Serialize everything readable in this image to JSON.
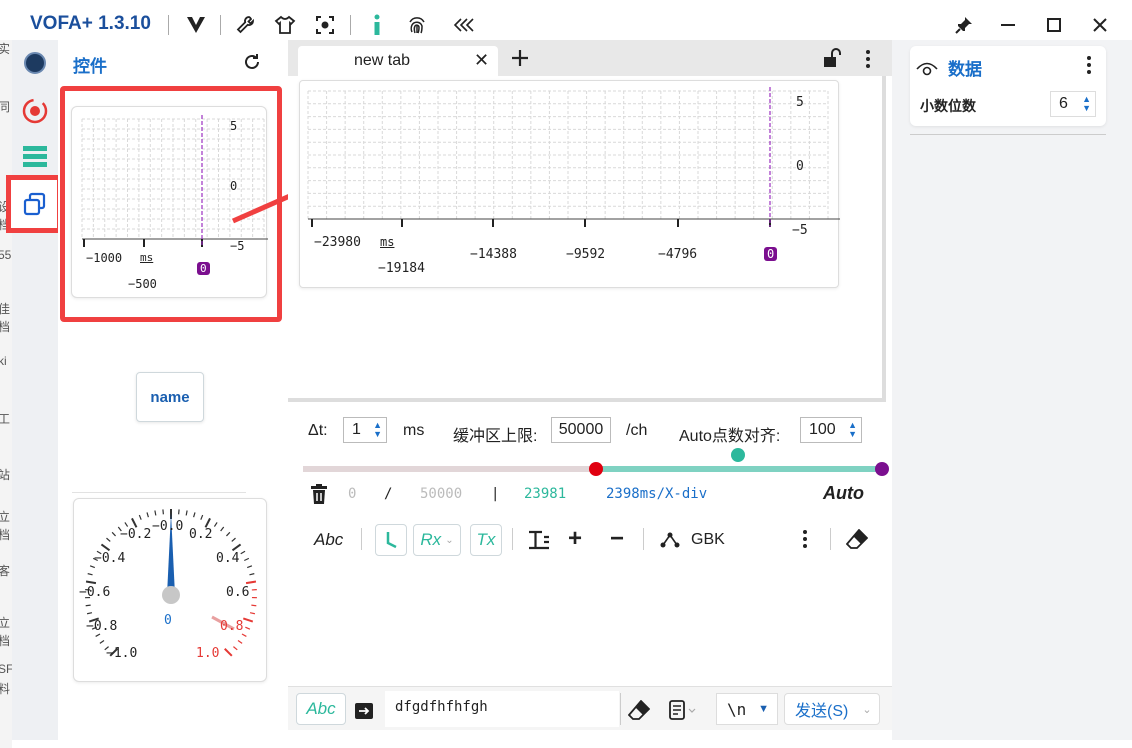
{
  "app": {
    "title": "VOFA+ 1.3.10"
  },
  "left_strip_chars": [
    "实",
    "同",
    "设",
    "档",
    "55",
    "佳",
    "档",
    "ki",
    "工",
    "站",
    "立",
    "档",
    "客",
    "立",
    "档",
    "SF",
    "料"
  ],
  "widget_panel": {
    "title": "控件",
    "mini_plot": {
      "y_ticks": [
        "5",
        "0",
        "−5"
      ],
      "x_ticks": [
        "−1000",
        "−500"
      ],
      "unit": "ms",
      "cursor_badge": "0"
    },
    "name_button": "name",
    "gauge": {
      "labels_left": [
        "−0.2",
        "−0.4",
        "−0.6",
        "−0.8",
        "−1.0"
      ],
      "labels_right": [
        "0.2",
        "0.4",
        "0.6",
        "0.8",
        "1.0"
      ],
      "top_label": "−0.0",
      "value": "0",
      "needle_value": 0
    }
  },
  "tabs": [
    {
      "label": "new tab",
      "active": true
    }
  ],
  "plot": {
    "y_ticks": [
      "5",
      "0",
      "−5"
    ],
    "x_ticks": [
      "−23980",
      "−19184",
      "−14388",
      "−9592",
      "−4796"
    ],
    "unit": "ms",
    "cursor_badge": "0"
  },
  "controls": {
    "dt_label": "Δt:",
    "dt_value": "1",
    "dt_unit": "ms",
    "buffer_label": "缓冲区上限:",
    "buffer_value": "50000",
    "buffer_unit": "/ch",
    "auto_label": "Auto点数对齐:",
    "auto_value": "100",
    "slider_split": 0.5
  },
  "status": {
    "count": "0",
    "sep1": "/",
    "limit": "50000",
    "sep2": "|",
    "received": "23981",
    "xdiv": "2398ms/X-div",
    "mode": "Auto"
  },
  "toolbar": {
    "abc": "Abc",
    "rx": "Rx",
    "tx": "Tx",
    "plus": "+",
    "minus": "−",
    "encoding": "GBK"
  },
  "send_bar": {
    "abc": "Abc",
    "input_value": "dfgdfhfhfgh",
    "newline": "\\n",
    "send": "发送(S)"
  },
  "right_panel": {
    "title": "数据",
    "decimal_label": "小数位数",
    "decimal_value": "6"
  },
  "colors": {
    "accent": "#1a6fc9",
    "highlight": "#f04040",
    "green": "#2cb89c",
    "purple": "#7b0f8f"
  }
}
